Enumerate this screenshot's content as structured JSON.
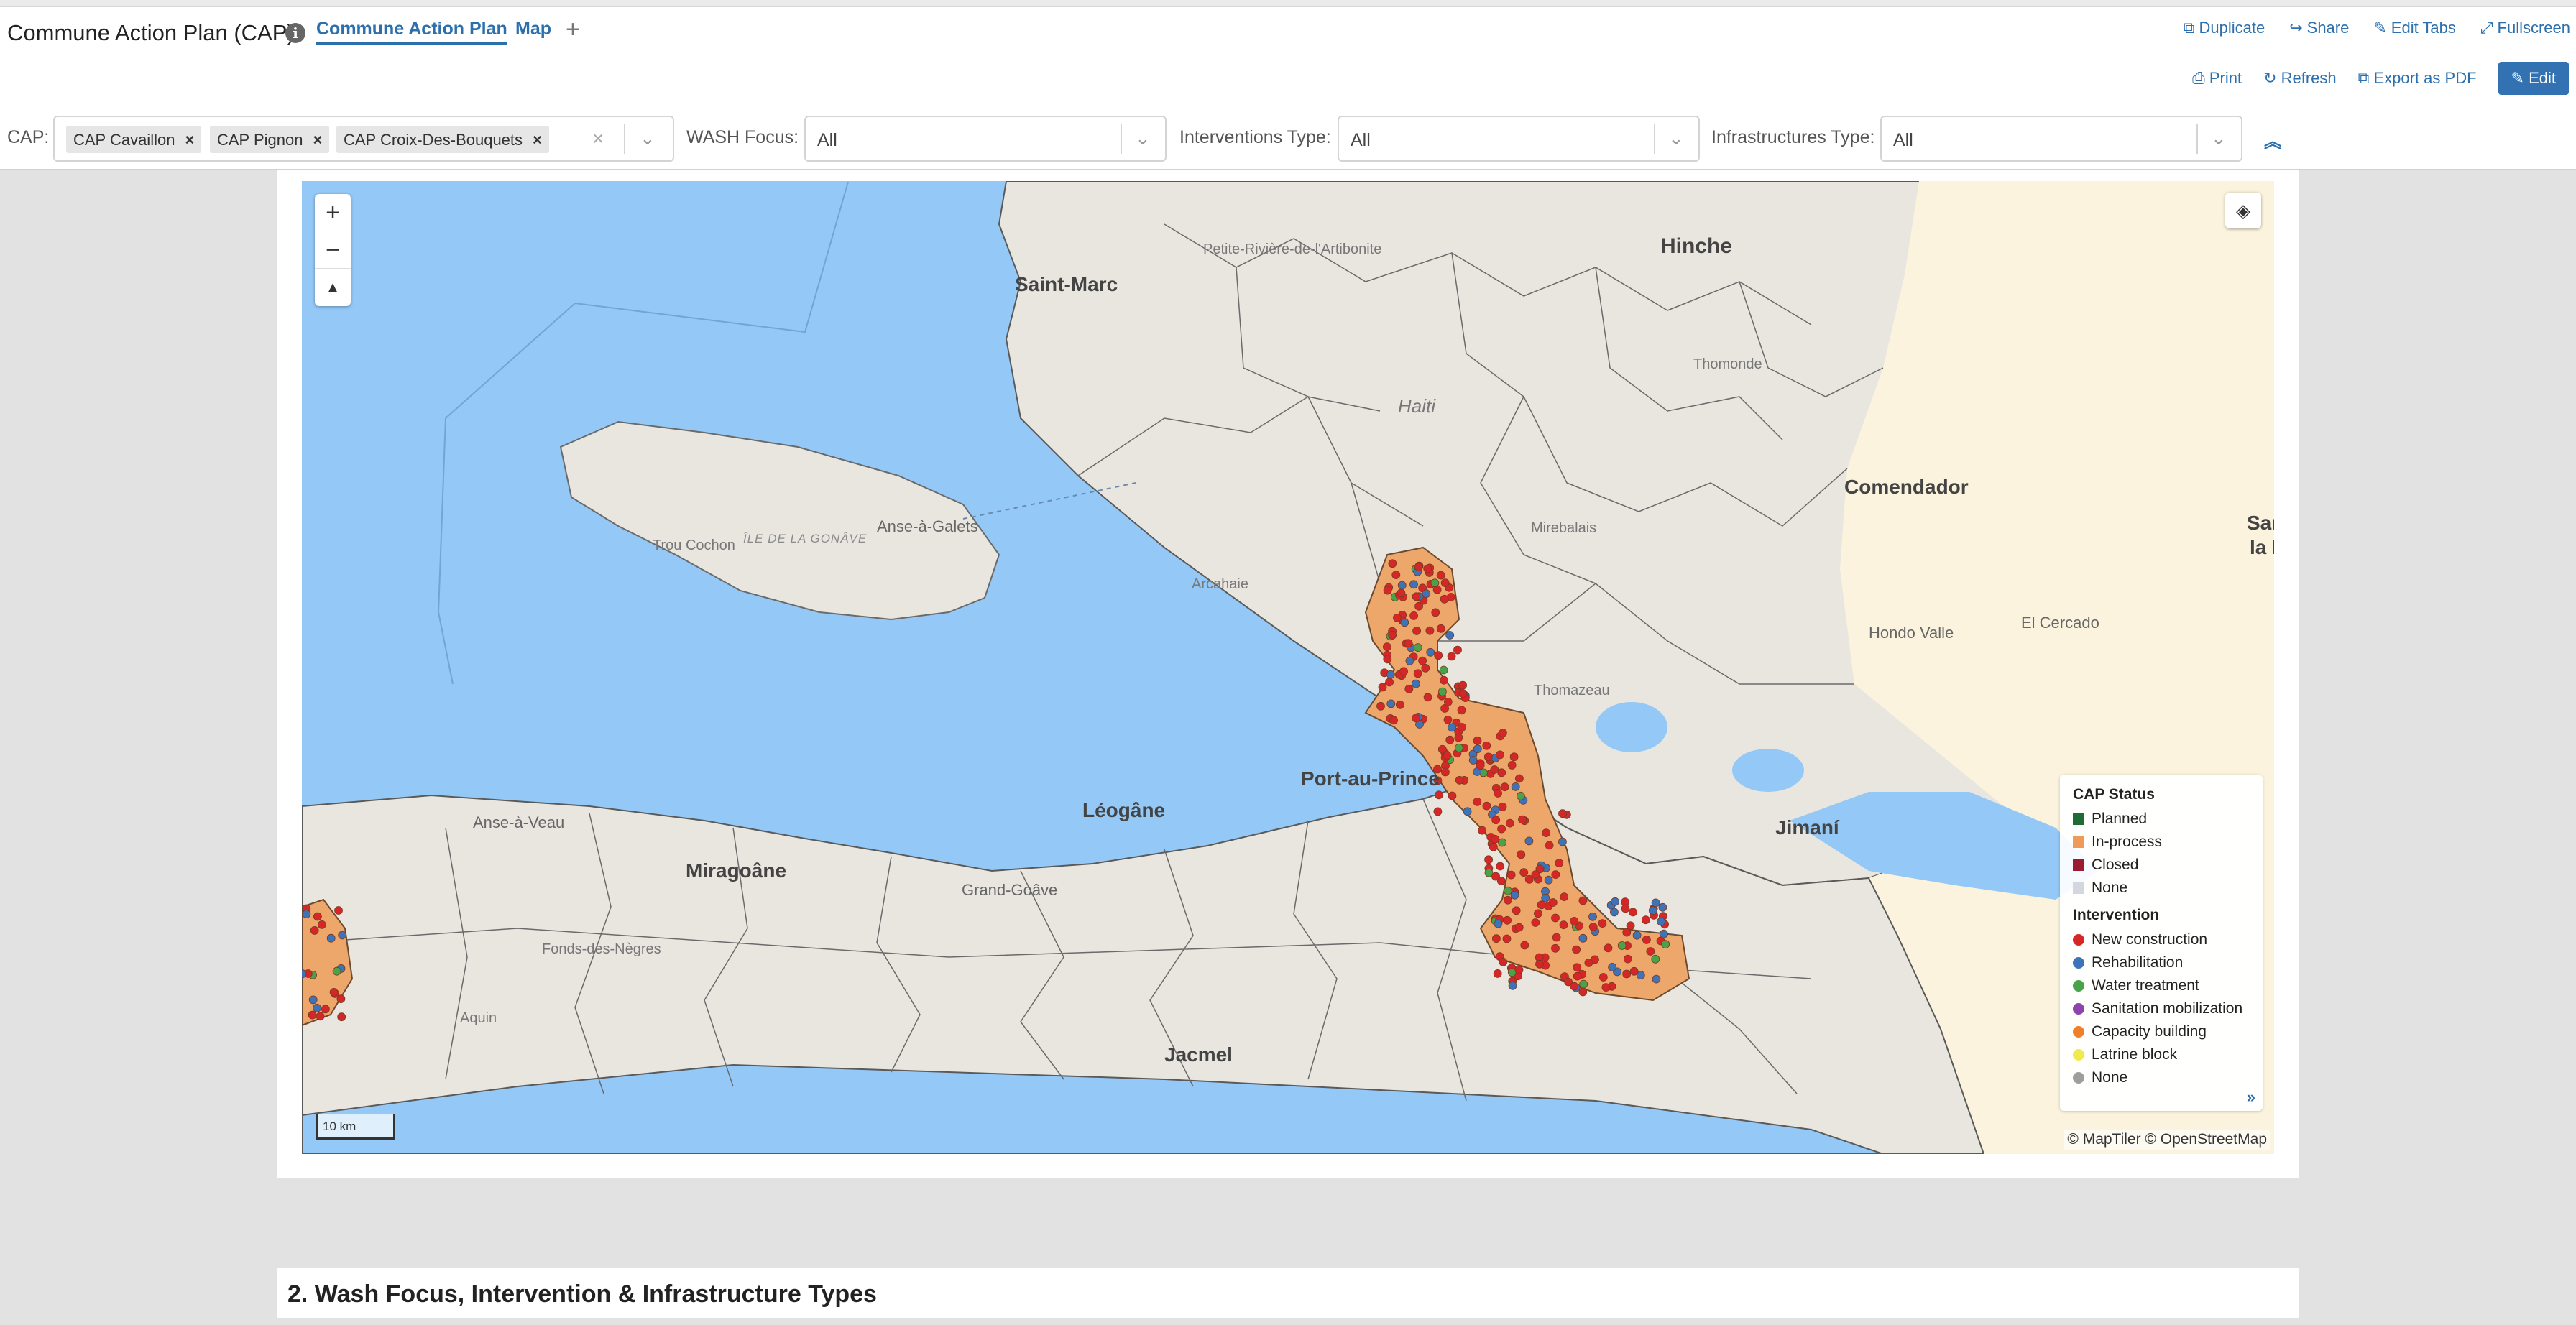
{
  "header": {
    "title": "Commune Action Plan (CAP)",
    "tabs": [
      {
        "label": "Commune Action Plan",
        "active": true
      },
      {
        "label": "Map",
        "active": false
      }
    ],
    "actions": [
      {
        "label": "Duplicate",
        "icon": "copy-icon"
      },
      {
        "label": "Share",
        "icon": "share-icon"
      },
      {
        "label": "Edit Tabs",
        "icon": "pencil-icon"
      },
      {
        "label": "Fullscreen",
        "icon": "expand-icon"
      }
    ]
  },
  "toolbar": {
    "print": "Print",
    "refresh": "Refresh",
    "export": "Export as PDF",
    "edit": "Edit",
    "edit_color": "#3272b2"
  },
  "filters": {
    "cap": {
      "label": "CAP:",
      "chips": [
        "CAP Cavaillon",
        "CAP Pignon",
        "CAP Croix-Des-Bouquets"
      ]
    },
    "wash_focus": {
      "label": "WASH Focus:",
      "value": "All"
    },
    "interventions_type": {
      "label": "Interventions Type:",
      "value": "All"
    },
    "infrastructures_type": {
      "label": "Infrastructures Type:",
      "value": "All"
    }
  },
  "map": {
    "colors": {
      "water": "#94c8f6",
      "land": "#e9e6e0",
      "neighbor_land": "#fbf3dd",
      "selected_commune": "#eea76a"
    },
    "places": {
      "saint_marc": "Saint-Marc",
      "petite_riviere": "Petite-Rivière-de-l'Artibonite",
      "hinche": "Hinche",
      "haiti": "Haiti",
      "thomonde": "Thomonde",
      "comendador": "Comendador",
      "san_juan_1": "San",
      "san_juan_2": "la I",
      "anse_a_galets": "Anse-à-Galets",
      "trou_cochon": "Trou Cochon",
      "ile_gonave": "ÎLE DE LA GONÂVE",
      "arcahaie": "Arcahaie",
      "mirebalais": "Mirebalais",
      "hondo_valle": "Hondo Valle",
      "el_cercado": "El Cercado",
      "thomazeau": "Thomazeau",
      "port_au_prince": "Port-au-Prince",
      "jimani": "Jimaní",
      "leogane": "Léogâne",
      "anse_a_veau": "Anse-à-Veau",
      "miragoane": "Miragoâne",
      "grand_goave": "Grand-Goâve",
      "fonds_des_negres": "Fonds-des-Nègres",
      "aquin": "Aquin",
      "jacmel": "Jacmel"
    },
    "scale_label": "10 km",
    "attribution": "© MapTiler © OpenStreetMap"
  },
  "legend": {
    "cap_status_title": "CAP Status",
    "cap_status": [
      {
        "label": "Planned",
        "color": "#1e6b35"
      },
      {
        "label": "In-process",
        "color": "#ef9a5a"
      },
      {
        "label": "Closed",
        "color": "#9b1b30"
      },
      {
        "label": "None",
        "color": "#d3d8e0"
      }
    ],
    "intervention_title": "Intervention",
    "intervention": [
      {
        "label": "New construction",
        "color": "#d62728"
      },
      {
        "label": "Rehabilitation",
        "color": "#3f73b8"
      },
      {
        "label": "Water treatment",
        "color": "#4aa34a"
      },
      {
        "label": "Sanitation mobilization",
        "color": "#8e44ad"
      },
      {
        "label": "Capacity building",
        "color": "#f07f2a"
      },
      {
        "label": "Latrine block",
        "color": "#f2e94e"
      },
      {
        "label": "None",
        "color": "#9e9e9e"
      }
    ]
  },
  "section2": {
    "title": "2. Wash Focus, Intervention & Infrastructure Types"
  }
}
